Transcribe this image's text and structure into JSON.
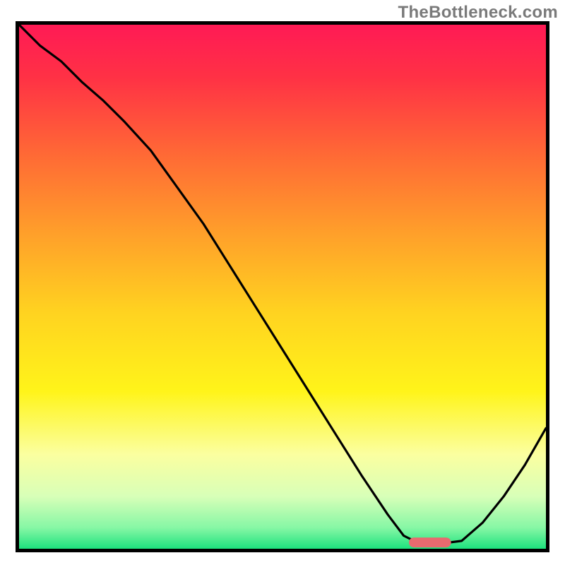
{
  "attribution": "TheBottleneck.com",
  "chart_data": {
    "type": "line",
    "title": "",
    "xlabel": "",
    "ylabel": "",
    "xlim": [
      0,
      100
    ],
    "ylim": [
      0,
      100
    ],
    "x": [
      0,
      4,
      8,
      12,
      16,
      20,
      25,
      30,
      35,
      40,
      45,
      50,
      55,
      60,
      65,
      70,
      73,
      76,
      80,
      84,
      88,
      92,
      96,
      100
    ],
    "values": [
      100,
      96,
      93,
      89,
      85.5,
      81.5,
      76,
      69,
      62,
      54,
      46,
      38,
      30,
      22,
      14,
      6.5,
      2.5,
      1,
      1,
      1.5,
      5,
      10,
      16,
      23
    ],
    "optimal_marker": {
      "x_start": 74,
      "x_end": 82,
      "y": 1.2
    },
    "gradient_stops": [
      {
        "pos": 0.0,
        "color": "#ff1a55"
      },
      {
        "pos": 0.1,
        "color": "#ff3145"
      },
      {
        "pos": 0.25,
        "color": "#ff6a35"
      },
      {
        "pos": 0.4,
        "color": "#ffa02a"
      },
      {
        "pos": 0.55,
        "color": "#ffd320"
      },
      {
        "pos": 0.7,
        "color": "#fff41a"
      },
      {
        "pos": 0.82,
        "color": "#fbffa0"
      },
      {
        "pos": 0.9,
        "color": "#d8ffb8"
      },
      {
        "pos": 0.96,
        "color": "#86f7a5"
      },
      {
        "pos": 1.0,
        "color": "#1de27e"
      }
    ]
  }
}
